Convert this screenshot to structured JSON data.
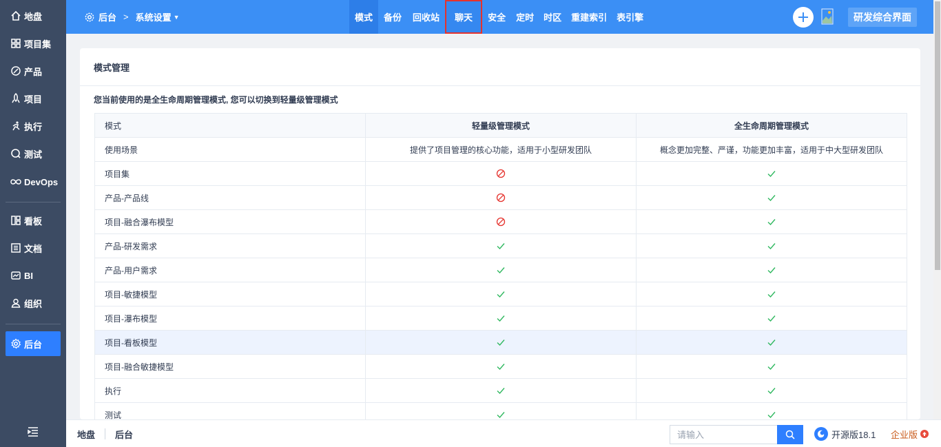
{
  "sidebar": {
    "items": [
      {
        "label": "地盘",
        "icon": "home-icon"
      },
      {
        "label": "项目集",
        "icon": "grid-icon"
      },
      {
        "label": "产品",
        "icon": "product-icon"
      },
      {
        "label": "项目",
        "icon": "project-icon"
      },
      {
        "label": "执行",
        "icon": "run-icon"
      },
      {
        "label": "测试",
        "icon": "test-icon"
      },
      {
        "label": "DevOps",
        "icon": "infinity-icon"
      },
      {
        "label": "看板",
        "icon": "kanban-icon"
      },
      {
        "label": "文档",
        "icon": "doc-icon"
      },
      {
        "label": "BI",
        "icon": "bi-icon"
      },
      {
        "label": "组织",
        "icon": "user-icon"
      },
      {
        "label": "后台",
        "icon": "gear-icon",
        "active": true
      }
    ]
  },
  "header": {
    "crumb_root": "后台",
    "crumb_sep": ">",
    "crumb_current": "系统设置",
    "nav": [
      "模式",
      "备份",
      "回收站",
      "聊天",
      "安全",
      "定时",
      "时区",
      "重建索引",
      "表引擎"
    ],
    "active_nav": "模式",
    "highlighted_nav": "聊天",
    "switch_button": "研发综合界面"
  },
  "panel": {
    "title": "模式管理",
    "intro": "您当前使用的是全生命周期管理模式, 您可以切换到轻量级管理模式",
    "columns": [
      "模式",
      "轻量级管理模式",
      "全生命周期管理模式"
    ],
    "scenario_row": {
      "label": "使用场景",
      "light": "提供了项目管理的核心功能，适用于小型研发团队",
      "full": "概念更加完整、严谨，功能更加丰富，适用于中大型研发团队"
    },
    "rows": [
      {
        "label": "项目集",
        "light": "no",
        "full": "yes"
      },
      {
        "label": "产品-产品线",
        "light": "no",
        "full": "yes"
      },
      {
        "label": "项目-融合瀑布模型",
        "light": "no",
        "full": "yes"
      },
      {
        "label": "产品-研发需求",
        "light": "yes",
        "full": "yes"
      },
      {
        "label": "产品-用户需求",
        "light": "yes",
        "full": "yes"
      },
      {
        "label": "项目-敏捷模型",
        "light": "yes",
        "full": "yes"
      },
      {
        "label": "项目-瀑布模型",
        "light": "yes",
        "full": "yes"
      },
      {
        "label": "项目-看板模型",
        "light": "yes",
        "full": "yes",
        "highlighted": true
      },
      {
        "label": "项目-融合敏捷模型",
        "light": "yes",
        "full": "yes"
      },
      {
        "label": "执行",
        "light": "yes",
        "full": "yes"
      },
      {
        "label": "测试",
        "light": "yes",
        "full": "yes"
      }
    ]
  },
  "footer": {
    "crumbs": [
      "地盘",
      "后台"
    ],
    "search_placeholder": "请输入",
    "edition": "开源版18.1",
    "enterprise": "企业版"
  },
  "colors": {
    "sidebar": "#3c4b63",
    "header": "#3b8ff5",
    "accent": "#2e7fff",
    "yes": "#2fb85f",
    "no": "#e5322d",
    "highlight_border": "#e5322d"
  }
}
